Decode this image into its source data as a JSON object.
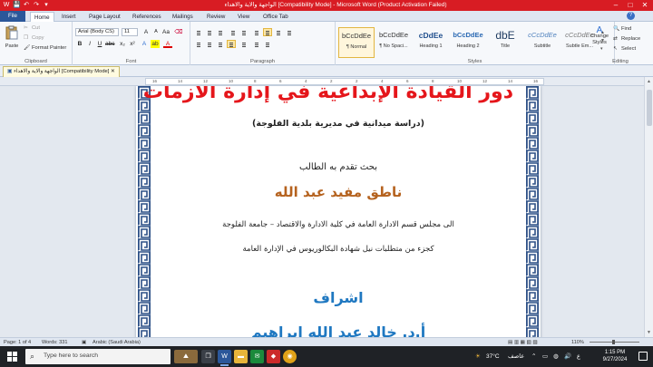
{
  "titlebar": {
    "title": "الواجهة والاية والاهداء [Compatibility Mode] - Microsoft Word (Product Activation Failed)",
    "quick_access": [
      "W",
      "💾",
      "↶",
      "↷",
      "▾"
    ],
    "controls": [
      "–",
      "□",
      "✕"
    ]
  },
  "tabs": [
    "File",
    "Home",
    "Insert",
    "Page Layout",
    "References",
    "Mailings",
    "Review",
    "View",
    "Office Tab"
  ],
  "active_tab": "Home",
  "ribbon": {
    "clipboard": {
      "paste": "Paste",
      "cut": "Cut",
      "copy": "Copy",
      "format_painter": "Format Painter",
      "label": "Clipboard"
    },
    "font": {
      "family": "Arial (Body CS)",
      "size": "11",
      "label": "Font"
    },
    "paragraph": {
      "label": "Paragraph"
    },
    "styles": {
      "label": "Styles",
      "items": [
        {
          "sample": "bCcDdEe",
          "name": "¶ Normal"
        },
        {
          "sample": "bCcDdEe",
          "name": "¶ No Spaci..."
        },
        {
          "sample": "cDdEe",
          "name": "Heading 1"
        },
        {
          "sample": "bCcDdEe",
          "name": "Heading 2"
        },
        {
          "sample": "dbE",
          "name": "Title"
        },
        {
          "sample": "cCcDdEe",
          "name": "Subtitle"
        },
        {
          "sample": "cCcDdEe",
          "name": "Subtle Em..."
        }
      ],
      "change_styles": "Change Styles"
    },
    "editing": {
      "find": "Find",
      "replace": "Replace",
      "select": "Select",
      "label": "Editing"
    }
  },
  "document_tab": "الواجهة والاية والاهداء [Compatibility Mode]",
  "ruler_ticks": [
    "16",
    "14",
    "12",
    "10",
    "8",
    "6",
    "4",
    "2",
    "2",
    "4",
    "6",
    "8",
    "10",
    "12",
    "14",
    "16"
  ],
  "document": {
    "title": "دور القيادة الإبداعية في إدارة الأزمات",
    "subtitle": "(دراسة ميدانية في مديرية بلدية الفلوجة)",
    "submitted_by": "بحث تقدم به الطالب",
    "student": "ناطق مفيد عبد الله",
    "line_council": "الى مجلس قسم الادارة العامة في كلية الادارة والاقتصاد – جامعة الفلوجة",
    "line_requirement": "كجزء من متطلبات نيل شهادة البكالوريوس في الإدارة العامة",
    "supervision": "اشراف",
    "supervisor": "أ.د. خالد عبد الله ابراهيم"
  },
  "status": {
    "page": "Page: 1 of 4",
    "words": "Words: 331",
    "language": "Arabic (Saudi Arabia)",
    "zoom": "110%"
  },
  "taskbar": {
    "search_placeholder": "Type here to search",
    "weather": "37°C",
    "weather_desc": "عاصف",
    "time": "1:15 PM",
    "date": "9/27/2024"
  }
}
